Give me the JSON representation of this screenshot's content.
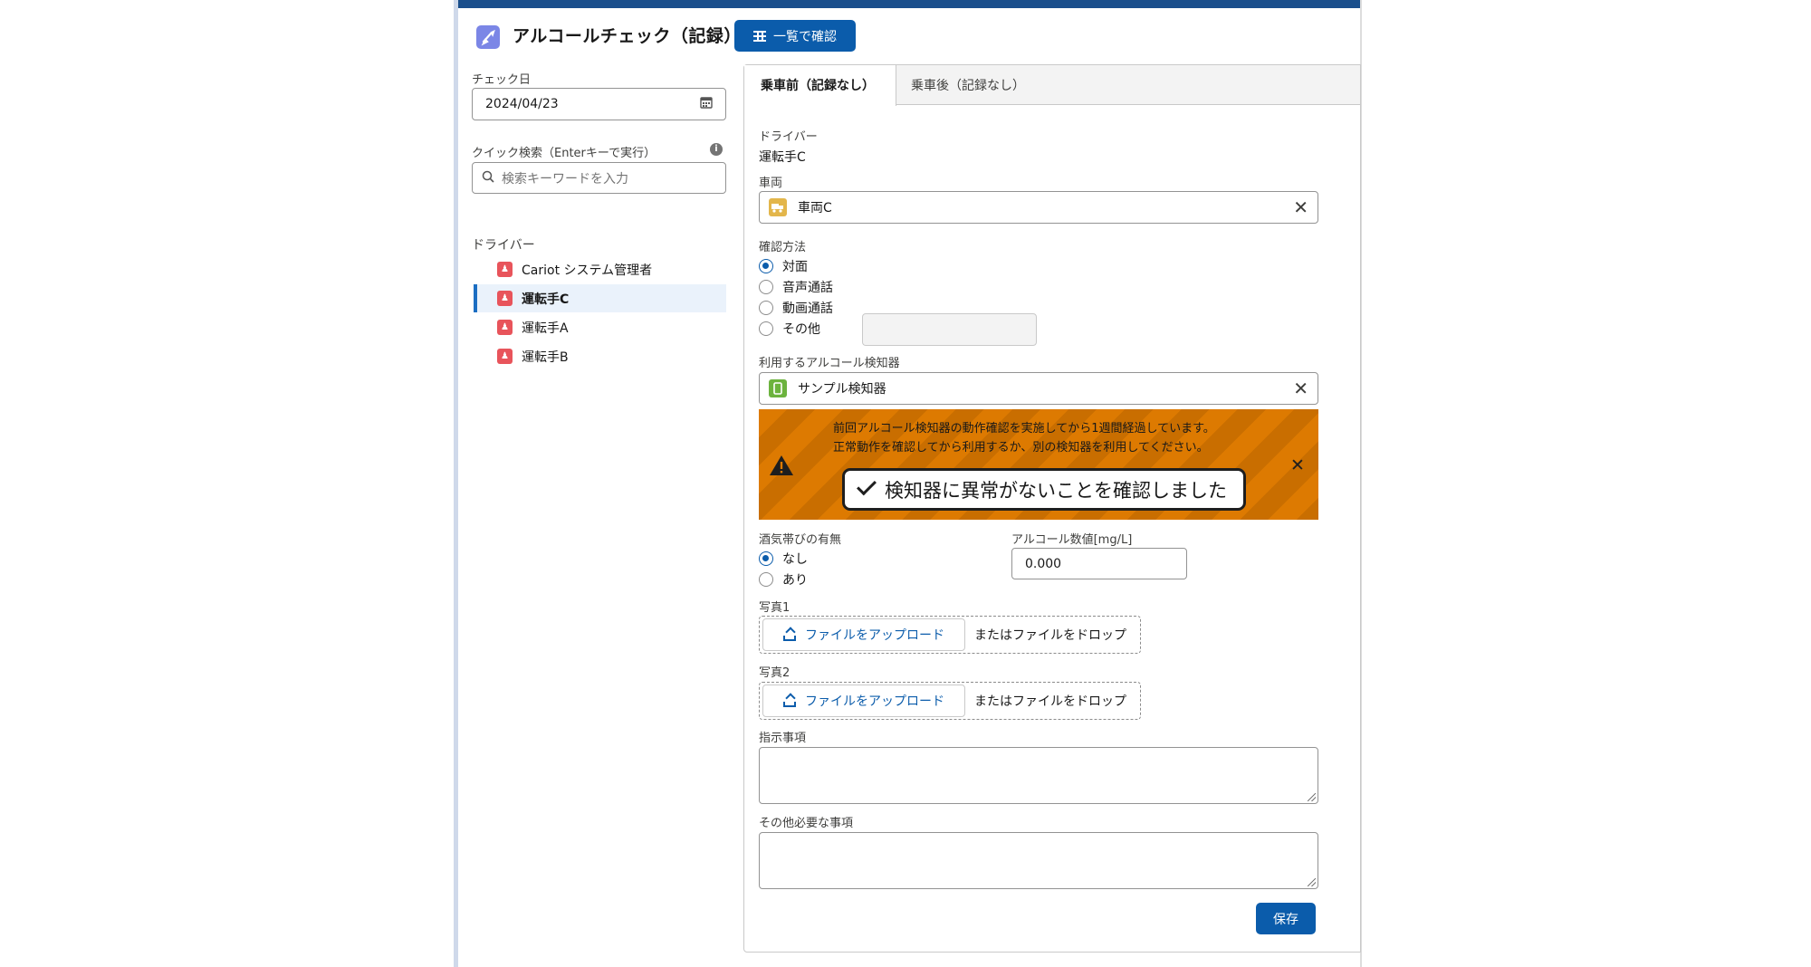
{
  "header": {
    "title": "アルコールチェック（記録）",
    "list_button_label": "一覧で確認"
  },
  "sidebar": {
    "check_date_label": "チェック日",
    "check_date_value": "2024/04/23",
    "quick_search_label": "クイック検索（Enterキーで実行）",
    "quick_search_placeholder": "検索キーワードを入力",
    "drivers_label": "ドライバー",
    "drivers": [
      {
        "name": "Cariot システム管理者",
        "selected": false
      },
      {
        "name": "運転手C",
        "selected": true
      },
      {
        "name": "運転手A",
        "selected": false
      },
      {
        "name": "運転手B",
        "selected": false
      }
    ]
  },
  "tabs": [
    {
      "label": "乗車前（記録なし）",
      "active": true
    },
    {
      "label": "乗車後（記録なし）",
      "active": false
    }
  ],
  "form": {
    "driver_label": "ドライバー",
    "driver_value": "運転手C",
    "vehicle_label": "車両",
    "vehicle_value": "車両C",
    "method_label": "確認方法",
    "method_options": [
      {
        "label": "対面",
        "checked": true
      },
      {
        "label": "音声通話",
        "checked": false
      },
      {
        "label": "動画通話",
        "checked": false
      },
      {
        "label": "その他",
        "checked": false
      }
    ],
    "detector_label": "利用するアルコール検知器",
    "detector_value": "サンプル検知器",
    "warning": {
      "line1": "前回アルコール検知器の動作確認を実施してから1週間経過しています。",
      "line2": "正常動作を確認してから利用するか、別の検知器を利用してください。",
      "confirm_label": "検知器に異常がないことを確認しました"
    },
    "odor_label": "酒気帯びの有無",
    "odor_options": [
      {
        "label": "なし",
        "checked": true
      },
      {
        "label": "あり",
        "checked": false
      }
    ],
    "alcohol_label": "アルコール数値[mg/L]",
    "alcohol_value": "0.000",
    "photo1_label": "写真1",
    "photo2_label": "写真2",
    "upload_label": "ファイルをアップロード",
    "drop_text": "またはファイルをドロップ",
    "instructions_label": "指示事項",
    "other_label": "その他必要な事項",
    "save_label": "保存"
  },
  "colors": {
    "brand_blue": "#0b5cab",
    "warning_orange": "#dd7a01",
    "driver_icon": "#e8545b",
    "vehicle_icon": "#e3b64b",
    "detector_icon": "#6cb33e",
    "app_icon": "#7b86e6"
  },
  "icons": {
    "app": "rocket-icon",
    "list": "grid-icon",
    "calendar": "calendar-icon",
    "search": "search-icon",
    "info": "info-icon",
    "driver": "user-icon",
    "vehicle": "truck-icon",
    "detector": "device-icon",
    "warning": "warning-icon",
    "close": "close-icon",
    "upload": "upload-icon",
    "check": "check-icon"
  }
}
